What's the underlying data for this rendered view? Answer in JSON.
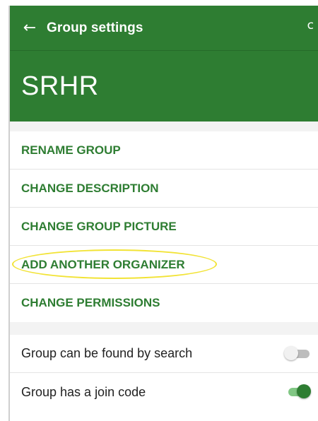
{
  "toolbar": {
    "back_icon": "arrow-left-icon",
    "back_glyph": "←",
    "title": "Group settings",
    "refresh_icon": "refresh-icon",
    "refresh_glyph": "c"
  },
  "header": {
    "group_name": "SRHR"
  },
  "menu": {
    "items": [
      {
        "label": "RENAME GROUP"
      },
      {
        "label": "CHANGE DESCRIPTION"
      },
      {
        "label": "CHANGE GROUP PICTURE"
      },
      {
        "label": "ADD ANOTHER ORGANIZER",
        "highlighted": true
      },
      {
        "label": "CHANGE PERMISSIONS"
      }
    ]
  },
  "settings": [
    {
      "label": "Group can be found by search",
      "enabled": false
    },
    {
      "label": "Group has a join code",
      "enabled": true
    }
  ],
  "colors": {
    "primary": "#2e7d32",
    "switch_track_on": "#81c784",
    "switch_off": "#bdbdbd",
    "highlight_ring": "#f2e335"
  }
}
